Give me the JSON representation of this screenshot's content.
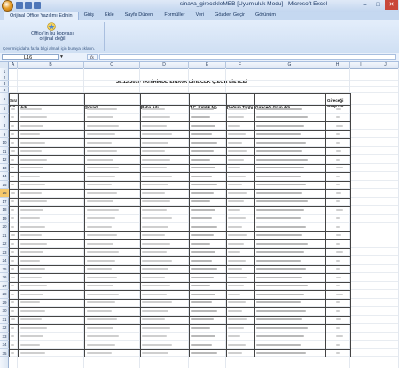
{
  "window": {
    "title": "sinava_girecekleMEB [Uyumluluk Modu] - Microsoft Excel",
    "controls": [
      "–",
      "□",
      "✕"
    ]
  },
  "tabs": [
    "Orijinal Office Yazılımı Edinin",
    "Giriş",
    "Ekle",
    "Sayfa Düzeni",
    "Formüller",
    "Veri",
    "Gözden Geçir",
    "Görünüm"
  ],
  "ribbon": {
    "line1": "Office'in bu kopyası",
    "line2": "orijinal değil",
    "note": "Çevrimiçi daha fazla bilgi almak için buraya tıklatın."
  },
  "formula_bar": {
    "name_box": "L16",
    "fx": "fx",
    "value": ""
  },
  "columns": [
    "A",
    "B",
    "C",
    "D",
    "E",
    "F",
    "G",
    "H",
    "I",
    "J"
  ],
  "row_numbers": [
    "1",
    "2",
    "3",
    "4",
    "5",
    "6",
    "7",
    "8",
    "9",
    "10",
    "11",
    "12",
    "13",
    "14",
    "15",
    "16",
    "17",
    "18",
    "19",
    "20",
    "21",
    "22",
    "23",
    "24",
    "25",
    "26",
    "27",
    "28",
    "29",
    "30",
    "31",
    "32",
    "33",
    "34",
    "35"
  ],
  "sheet": {
    "title": "25.12.2010 TARİHİNDE SINAVA GİRECEK Ç.SGB LİSTESİ",
    "headers": {
      "sira_no_1": "Sıra",
      "sira_no_2": "No",
      "adi": "Adı",
      "soyadi": "Soyadı",
      "baba_adi": "Baba Adı",
      "tc": "T.C. Kimlik No",
      "dogum": "Doğum Tarihi",
      "grup_adi": "Gireceği Grup Adı",
      "grup_no_1": "Gireceği",
      "grup_no_2": "Grup No"
    }
  },
  "colors": {
    "accent": "#c5d8f0",
    "selected_row": "#f5c86b"
  }
}
